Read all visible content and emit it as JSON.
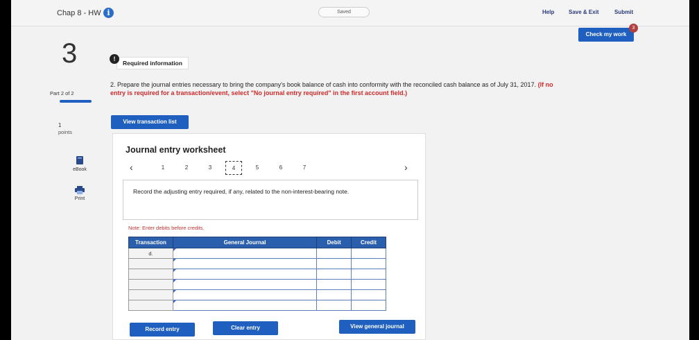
{
  "header": {
    "assignment_title": "Chap 8 - HW",
    "saved_label": "Saved",
    "help_label": "Help",
    "save_exit_label": "Save & Exit",
    "submit_label": "Submit",
    "check_label": "Check my work",
    "check_badge": "3"
  },
  "question": {
    "number": "3",
    "required_icon": "!",
    "required_label": "Required information",
    "part_label": "Part 2 of 2",
    "points_value": "1",
    "points_label": "points",
    "instruction_main": "2. Prepare the journal entries necessary to bring the company's book balance of cash into conformity with the reconciled cash balance as of July 31, 2017.",
    "instruction_red": "(If no entry is required for a transaction/event, select \"No journal entry required\" in the first account field.)",
    "view_transactions_label": "View transaction list"
  },
  "sidebar": {
    "ebook_label": "eBook",
    "print_label": "Print"
  },
  "worksheet": {
    "title": "Journal entry worksheet",
    "pages": [
      "1",
      "2",
      "3",
      "4",
      "5",
      "6",
      "7"
    ],
    "active_page": "4",
    "prompt": "Record the adjusting entry required, if any, related to the non-interest-bearing note.",
    "note": "Note: Enter debits before credits.",
    "columns": {
      "transaction": "Transaction",
      "journal": "General Journal",
      "debit": "Debit",
      "credit": "Credit"
    },
    "rows": [
      {
        "transaction": "d."
      },
      {
        "transaction": ""
      },
      {
        "transaction": ""
      },
      {
        "transaction": ""
      },
      {
        "transaction": ""
      },
      {
        "transaction": ""
      }
    ],
    "record_label": "Record entry",
    "clear_label": "Clear entry",
    "view_journal_label": "View general journal"
  },
  "colors": {
    "accent": "#1e5fbf",
    "warning": "#d12a2a"
  }
}
